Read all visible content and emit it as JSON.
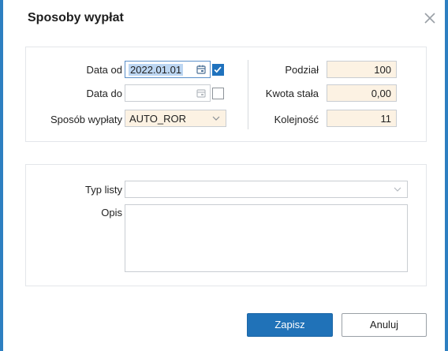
{
  "dialog": {
    "title": "Sposoby wypłat",
    "close_icon": "close-icon"
  },
  "form": {
    "data_od": {
      "label": "Data od",
      "value": "2022.01.01",
      "checked": true
    },
    "data_do": {
      "label": "Data do",
      "value": "",
      "checked": false
    },
    "sposob_wyplaty": {
      "label": "Sposób wypłaty",
      "value": "AUTO_ROR"
    },
    "podzial": {
      "label": "Podział",
      "value": "100"
    },
    "kwota_stala": {
      "label": "Kwota stała",
      "value": "0,00"
    },
    "kolejnosc": {
      "label": "Kolejność",
      "value": "11"
    },
    "typ_listy": {
      "label": "Typ listy",
      "value": ""
    },
    "opis": {
      "label": "Opis",
      "value": ""
    }
  },
  "buttons": {
    "save": "Zapisz",
    "cancel": "Anuluj"
  },
  "colors": {
    "accent": "#2072b8",
    "readonly_bg": "#fcf2e3",
    "selection": "#bcd6f2"
  },
  "icons": [
    "close-icon",
    "calendar-icon",
    "check-icon",
    "chevron-down-icon"
  ]
}
